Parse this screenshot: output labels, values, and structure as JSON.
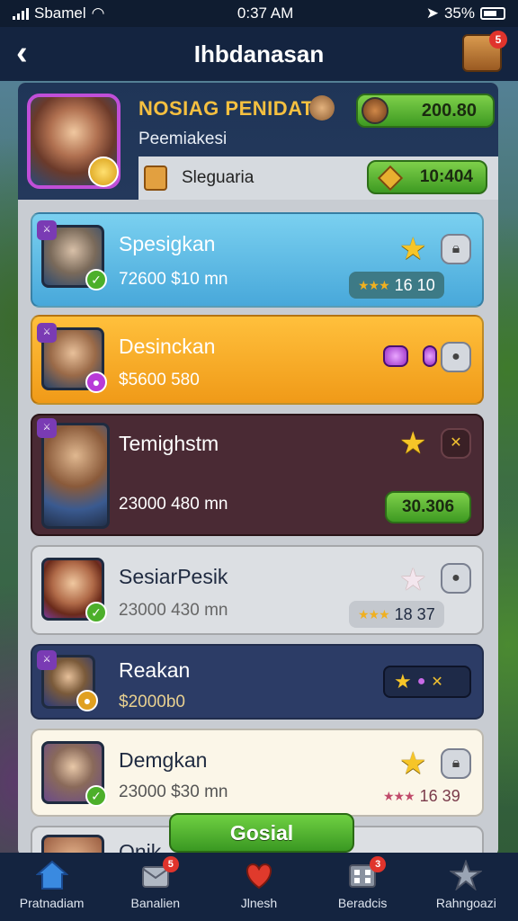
{
  "status_bar": {
    "carrier": "Sbamel",
    "time": "0:37 AM",
    "battery": "35%"
  },
  "header": {
    "title": "Ihbdanasan",
    "chest_badge": "5"
  },
  "profile": {
    "name": "NOSIAG PENIDAT",
    "subtitle": "Peemiakesi",
    "currency_1": "200.80",
    "inventory_label": "Sleguaria",
    "currency_2": "10:404"
  },
  "cards": [
    {
      "name": "Spesigkan",
      "value": "72600 $10 mn",
      "rating": "16  10",
      "level": "lv"
    },
    {
      "name": "Desinckan",
      "value": "$5600 580"
    },
    {
      "name": "Temighstm",
      "value": "23000 480 mn",
      "button": "30.306"
    },
    {
      "name": "SesiarPesik",
      "value": "23000 430 mn",
      "rating": "18  37"
    },
    {
      "name": "Reakan",
      "value": "$2000b0"
    },
    {
      "name": "Demgkan",
      "value": "23000 $30 mn",
      "rating": "16  39"
    },
    {
      "name": "Onik"
    }
  ],
  "social_button": "Gosial",
  "nav": [
    {
      "label": "Pratnadiam",
      "icon": "home-icon",
      "badge": ""
    },
    {
      "label": "Banalien",
      "icon": "mail-icon",
      "badge": "5"
    },
    {
      "label": "Jlnesh",
      "icon": "heart-icon",
      "badge": ""
    },
    {
      "label": "Beradcis",
      "icon": "grid-icon",
      "badge": "3"
    },
    {
      "label": "Rahngoazi",
      "icon": "star-icon",
      "badge": ""
    }
  ],
  "colors": {
    "accent_green": "#4caf2a",
    "panel": "#c8ccd2",
    "header": "#142440",
    "gold": "#f6c528"
  }
}
